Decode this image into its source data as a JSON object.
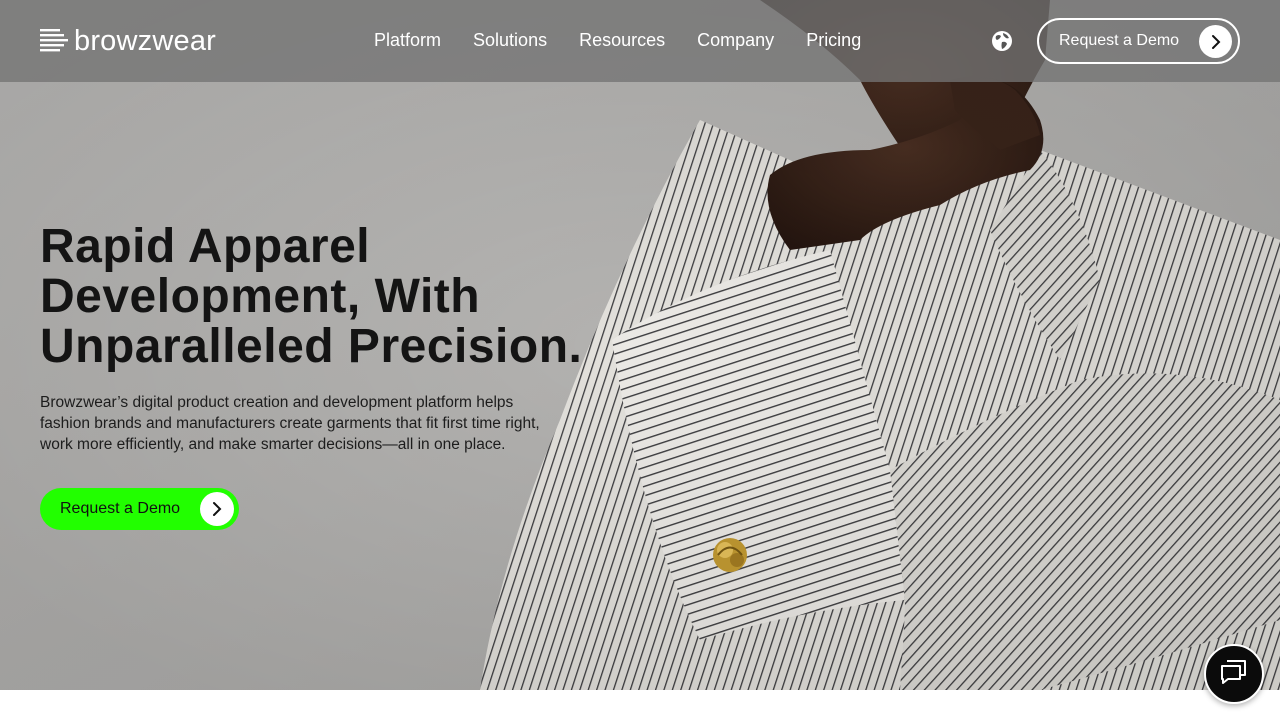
{
  "brand": {
    "name": "browzwear",
    "logo_icon": "browzwear-logo-icon"
  },
  "nav": {
    "items": [
      {
        "label": "Platform"
      },
      {
        "label": "Solutions"
      },
      {
        "label": "Resources"
      },
      {
        "label": "Company"
      },
      {
        "label": "Pricing"
      }
    ],
    "language_icon": "globe-icon",
    "cta_label": "Request a Demo"
  },
  "hero": {
    "headline_lines": [
      "Rapid Apparel",
      "Development, With",
      "Unparalleled Precision."
    ],
    "description_lines": [
      "Browzwear’s digital product creation and development platform helps",
      "fashion brands and manufacturers create garments that fit first time right,",
      "work more efficiently, and make smarter decisions—all in one place."
    ],
    "cta_label": "Request a Demo",
    "image_subject": "model in striped shirt with gold knot cufflink"
  },
  "chat": {
    "icon": "chat-bubbles-icon"
  },
  "colors": {
    "accent_green": "#22ff00",
    "header_bg": "#737373",
    "text_dark": "#141414",
    "white": "#ffffff"
  }
}
